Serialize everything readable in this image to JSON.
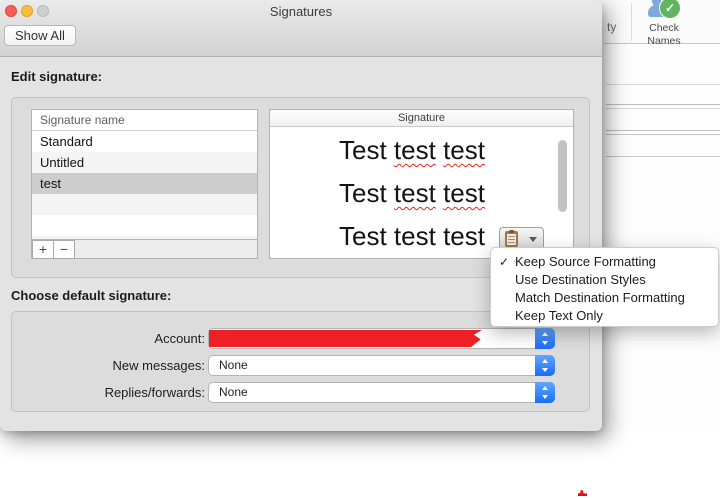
{
  "window": {
    "title": "Signatures",
    "show_all_label": "Show All"
  },
  "edit_section": {
    "heading": "Edit signature:",
    "list": {
      "header": "Signature name",
      "rows": [
        "Standard",
        "Untitled",
        "test"
      ],
      "selected_row": "test",
      "add_label": "+",
      "remove_label": "−"
    },
    "preview": {
      "header": "Signature",
      "lines": [
        {
          "w1": "Test",
          "w2": "test",
          "w3": "test",
          "spellcheck_underline": true
        },
        {
          "w1": "Test",
          "w2": "test",
          "w3": "test",
          "spellcheck_underline": true
        },
        {
          "w1": "Test",
          "w2": "test",
          "w3": "test",
          "spellcheck_underline": false
        }
      ]
    }
  },
  "paste_menu": {
    "checkmark": "✓",
    "items": [
      {
        "label": "Keep Source Formatting",
        "checked": true
      },
      {
        "label": "Use Destination Styles",
        "checked": false
      },
      {
        "label": "Match Destination Formatting",
        "checked": false
      },
      {
        "label": "Keep Text Only",
        "checked": false
      }
    ]
  },
  "default_section": {
    "heading": "Choose default signature:",
    "rows": [
      {
        "label": "Account:",
        "value": "",
        "redacted": true
      },
      {
        "label": "New messages:",
        "value": "None"
      },
      {
        "label": "Replies/forwards:",
        "value": "None"
      }
    ]
  },
  "background_window": {
    "toolbar_text_fragment": "ty",
    "check_names": {
      "line1": "Check",
      "line2": "Names"
    }
  },
  "colors": {
    "accent_blue": "#1a6cf3",
    "redaction_red": "#ee2026",
    "selection_gray": "#cdcdcd",
    "squiggle_red": "#e0281e"
  }
}
